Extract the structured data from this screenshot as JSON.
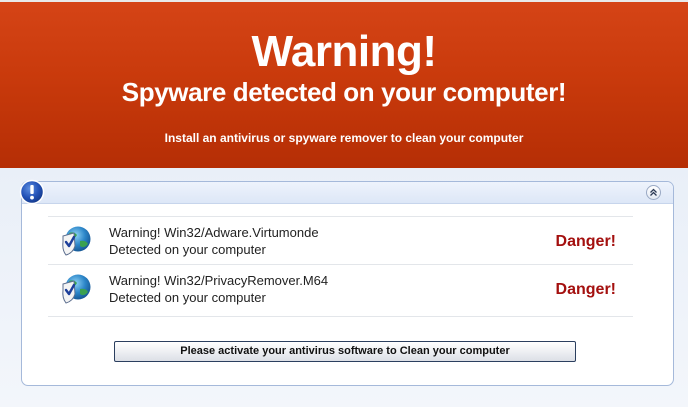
{
  "banner": {
    "title": "Warning!",
    "subtitle": "Spyware detected on your computer!",
    "note": "Install an antivirus or spyware remover to clean your computer"
  },
  "panel": {
    "header_icon": "info-icon",
    "collapse_icon": "double-chevron-up-icon"
  },
  "threats": [
    {
      "name": "Warning! Win32/Adware.Virtumonde",
      "status": "Detected on your computer",
      "severity": "Danger!",
      "icon": "shield-check-icon"
    },
    {
      "name": "Warning! Win32/PrivacyRemover.M64",
      "status": "Detected on your computer",
      "severity": "Danger!",
      "icon": "shield-check-icon"
    }
  ],
  "action": {
    "label": "Please activate your antivirus software to Clean your computer"
  },
  "colors": {
    "banner": "#c93a0c",
    "danger": "#a4100f",
    "panel_border": "#a5b9da"
  }
}
